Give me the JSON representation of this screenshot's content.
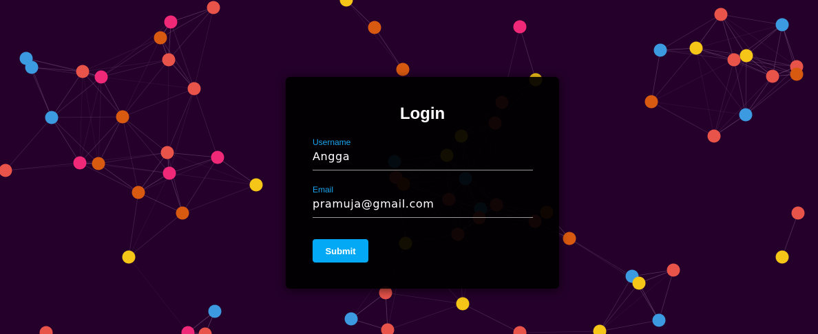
{
  "background_color": "#24002a",
  "node_colors": [
    "#e8534a",
    "#f02878",
    "#d85a10",
    "#f5c518",
    "#3c9ae0"
  ],
  "login": {
    "title": "Login",
    "username_label": "Username",
    "username_value": "Angga",
    "email_label": "Email",
    "email_value": "pramuja@gmail.com",
    "submit_label": "Submit",
    "accent_color": "#03a9f4"
  }
}
